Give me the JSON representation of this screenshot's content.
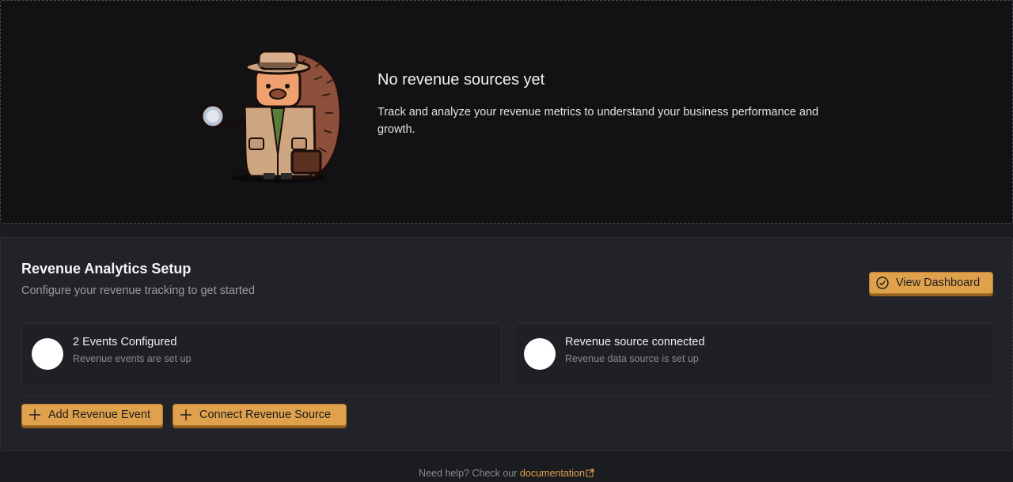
{
  "empty_state": {
    "title": "No revenue sources yet",
    "description": "Track and analyze your revenue metrics to understand your business performance and growth."
  },
  "setup": {
    "title": "Revenue Analytics Setup",
    "subtitle": "Configure your revenue tracking to get started",
    "view_dashboard_label": "View Dashboard",
    "cards": [
      {
        "title": "2 Events Configured",
        "subtitle": "Revenue events are set up"
      },
      {
        "title": "Revenue source connected",
        "subtitle": "Revenue data source is set up"
      }
    ],
    "add_event_label": "Add Revenue Event",
    "connect_source_label": "Connect Revenue Source"
  },
  "footer": {
    "prefix": "Need help? Check our",
    "link_label": "documentation"
  },
  "colors": {
    "accent": "#e0a14d",
    "page_background": "#1b1c1f",
    "card_background": "#222329"
  },
  "icons": {
    "view_dashboard": "check-circle-icon",
    "add": "plus-icon",
    "external": "external-link-icon"
  }
}
